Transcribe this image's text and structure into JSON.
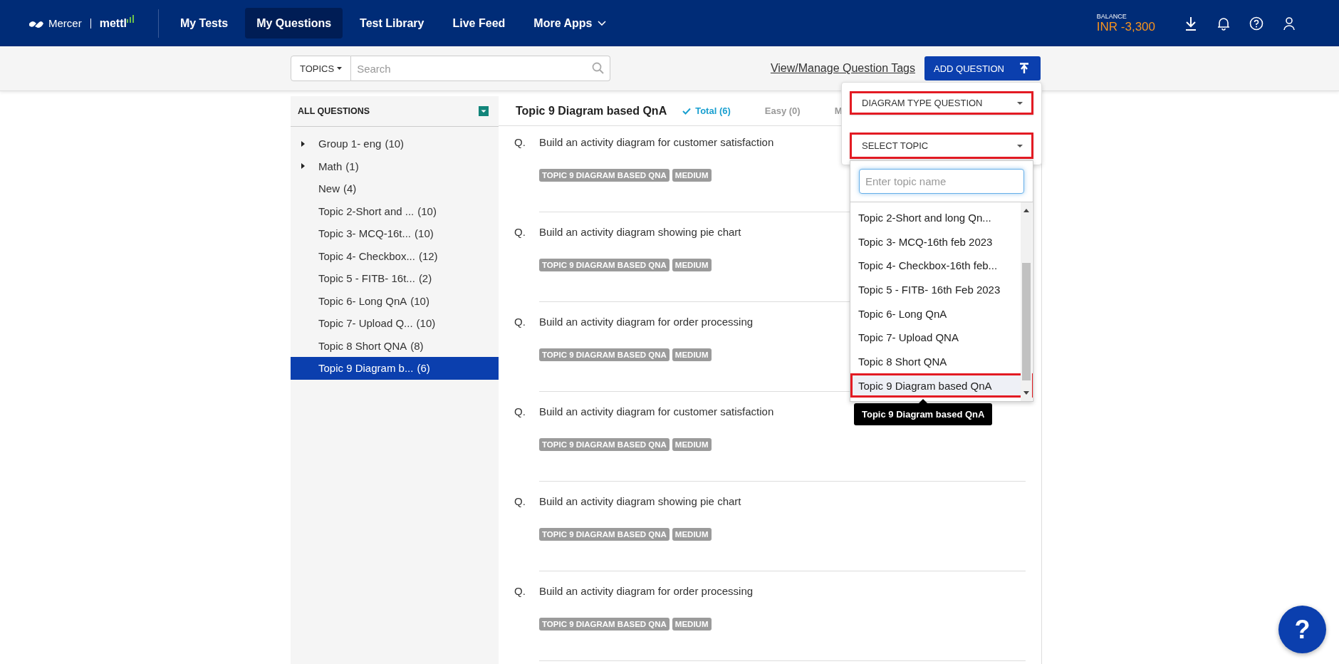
{
  "header": {
    "logo": {
      "brand": "Mercer",
      "product": "mettl"
    },
    "nav": [
      {
        "label": "My Tests",
        "selected": false,
        "kind": "link"
      },
      {
        "label": "My Questions",
        "selected": true,
        "kind": "link"
      },
      {
        "label": "Test Library",
        "selected": false,
        "kind": "link"
      },
      {
        "label": "Live Feed",
        "selected": false,
        "kind": "link"
      },
      {
        "label": "More Apps",
        "selected": false,
        "kind": "menu"
      }
    ],
    "balance": {
      "label": "BALANCE",
      "value": "INR -3,300"
    }
  },
  "toolbar": {
    "filter_button": "TOPICS",
    "search": {
      "placeholder": "Search"
    },
    "tags_link": "View/Manage Question Tags",
    "add_button": "ADD QUESTION"
  },
  "sidebar": {
    "title": "ALL QUESTIONS",
    "items": [
      {
        "name": "Group 1- eng",
        "count": "(10)",
        "kind": "group",
        "selected": false
      },
      {
        "name": "Math",
        "count": "(1)",
        "kind": "group",
        "selected": false
      },
      {
        "name": "New",
        "count": "(4)",
        "kind": "topic",
        "selected": false
      },
      {
        "name": "Topic 2-Short and ...",
        "count": "(10)",
        "kind": "topic",
        "selected": false
      },
      {
        "name": "Topic 3- MCQ-16t...",
        "count": "(10)",
        "kind": "topic",
        "selected": false
      },
      {
        "name": "Topic 4- Checkbox...",
        "count": "(12)",
        "kind": "topic",
        "selected": false
      },
      {
        "name": "Topic 5 - FITB- 16t...",
        "count": "(2)",
        "kind": "topic",
        "selected": false
      },
      {
        "name": "Topic 6- Long QnA",
        "count": "(10)",
        "kind": "topic",
        "selected": false
      },
      {
        "name": "Topic 7- Upload Q...",
        "count": "(10)",
        "kind": "topic",
        "selected": false
      },
      {
        "name": "Topic 8 Short QNA",
        "count": "(8)",
        "kind": "topic",
        "selected": false
      },
      {
        "name": "Topic 9 Diagram b...",
        "count": "(6)",
        "kind": "topic",
        "selected": true
      }
    ]
  },
  "main": {
    "title": "Topic 9 Diagram based QnA",
    "filters": [
      {
        "label": "Total (6)",
        "selected": true
      },
      {
        "label": "Easy (0)",
        "selected": false
      },
      {
        "label": "M",
        "selected": false
      }
    ],
    "questions": [
      {
        "prefix": "Q.",
        "text": "Build an activity diagram for customer satisfaction",
        "tags": [
          "TOPIC 9 DIAGRAM BASED QNA",
          "MEDIUM"
        ]
      },
      {
        "prefix": "Q.",
        "text": "Build an activity diagram showing pie chart",
        "tags": [
          "TOPIC 9 DIAGRAM BASED QNA",
          "MEDIUM"
        ]
      },
      {
        "prefix": "Q.",
        "text": "Build an activity diagram for order processing",
        "tags": [
          "TOPIC 9 DIAGRAM BASED QNA",
          "MEDIUM"
        ]
      },
      {
        "prefix": "Q.",
        "text": "Build an activity diagram for customer satisfaction",
        "tags": [
          "TOPIC 9 DIAGRAM BASED QNA",
          "MEDIUM"
        ]
      },
      {
        "prefix": "Q.",
        "text": "Build an activity diagram showing pie chart",
        "tags": [
          "TOPIC 9 DIAGRAM BASED QNA",
          "MEDIUM"
        ]
      },
      {
        "prefix": "Q.",
        "text": "Build an activity diagram for order processing",
        "tags": [
          "TOPIC 9 DIAGRAM BASED QNA",
          "MEDIUM"
        ]
      }
    ]
  },
  "add_menu": {
    "type_select": {
      "value": "DIAGRAM TYPE QUESTION",
      "highlighted": true
    },
    "topic_select": {
      "value": "SELECT TOPIC",
      "highlighted": true
    },
    "topic_search": {
      "placeholder": "Enter topic name"
    },
    "topics": [
      {
        "label": "Topic 2-Short and long Qn...",
        "selected": false,
        "highlighted": false
      },
      {
        "label": "Topic 3- MCQ-16th feb 2023",
        "selected": false,
        "highlighted": false
      },
      {
        "label": "Topic 4- Checkbox-16th feb...",
        "selected": false,
        "highlighted": false
      },
      {
        "label": "Topic 5 - FITB- 16th Feb 2023",
        "selected": false,
        "highlighted": false
      },
      {
        "label": "Topic 6- Long QnA",
        "selected": false,
        "highlighted": false
      },
      {
        "label": "Topic 7- Upload QNA",
        "selected": false,
        "highlighted": false
      },
      {
        "label": "Topic 8 Short QNA",
        "selected": false,
        "highlighted": false
      },
      {
        "label": "Topic 9 Diagram based QnA",
        "selected": true,
        "highlighted": true
      }
    ],
    "tooltip": "Topic 9 Diagram based QnA"
  },
  "help_button": {
    "label": "?"
  }
}
